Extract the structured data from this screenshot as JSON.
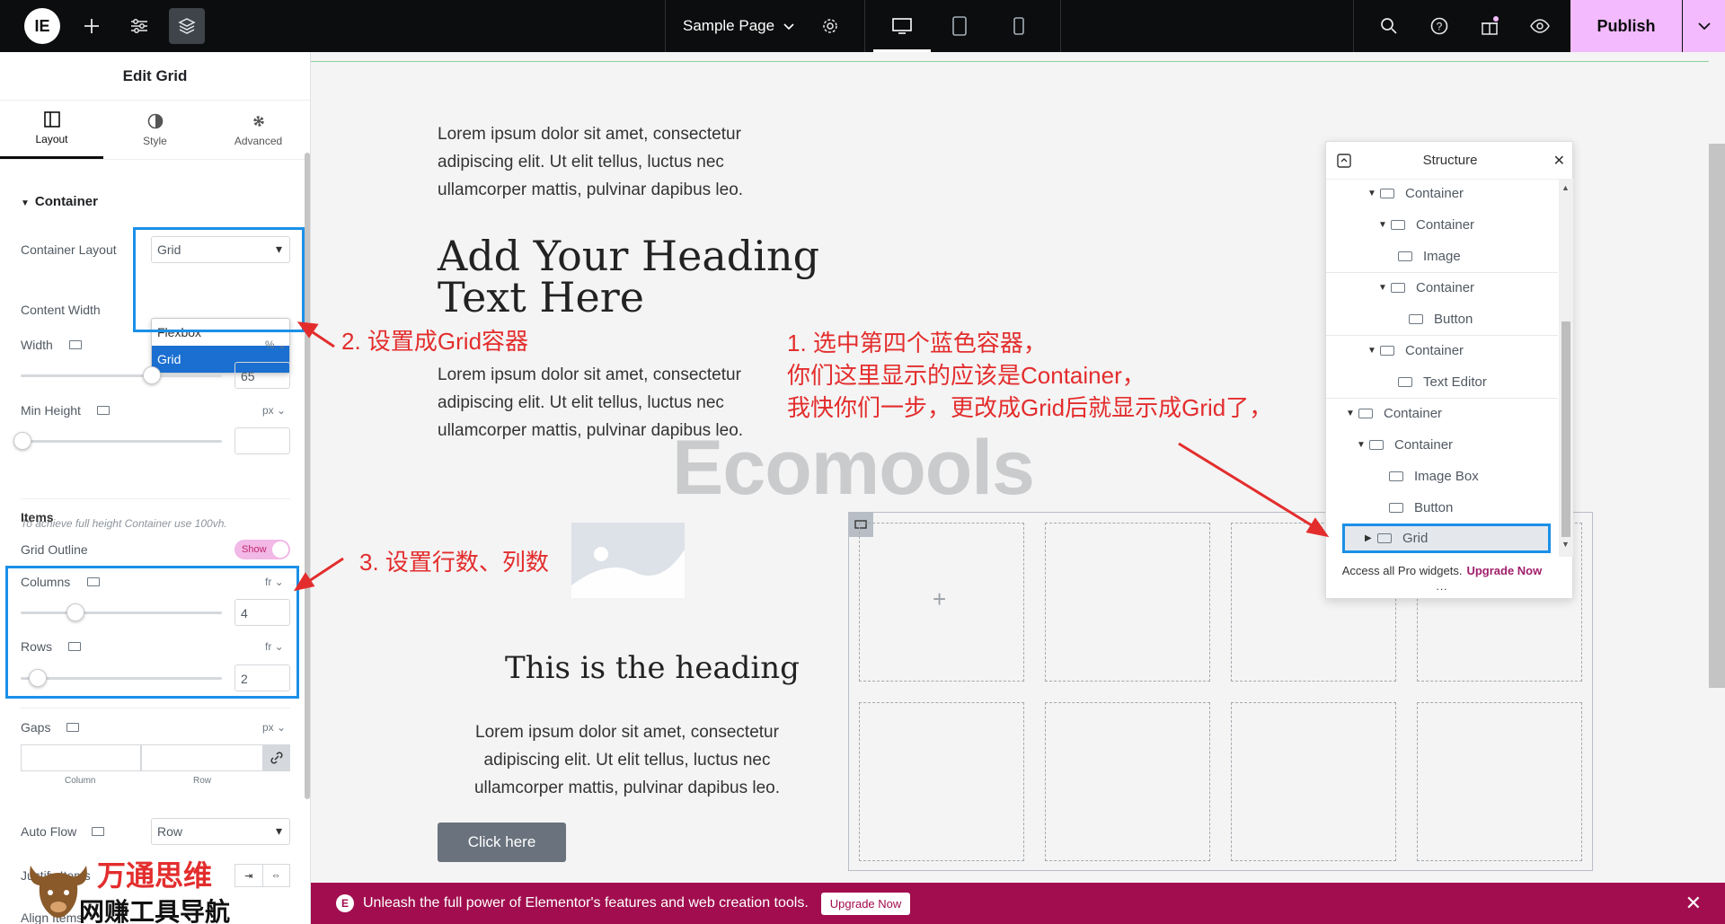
{
  "topbar": {
    "page_name": "Sample Page",
    "publish_label": "Publish"
  },
  "panel": {
    "title": "Edit Grid",
    "tabs": [
      {
        "label": "Layout",
        "active": true
      },
      {
        "label": "Style",
        "active": false
      },
      {
        "label": "Advanced",
        "active": false
      }
    ],
    "section": "Container",
    "container_layout": {
      "label": "Container Layout",
      "value": "Grid",
      "options": [
        "Flexbox",
        "Grid"
      ]
    },
    "content_width_label": "Content Width",
    "width": {
      "label": "Width",
      "unit": "%",
      "value": "65",
      "level": 0.65
    },
    "min_height": {
      "label": "Min Height",
      "unit": "px",
      "value": "",
      "hint": "To achieve full height Container use 100vh."
    },
    "items_heading": "Items",
    "grid_outline": {
      "label": "Grid Outline",
      "state": "Show"
    },
    "columns": {
      "label": "Columns",
      "unit": "fr",
      "value": "4"
    },
    "rows": {
      "label": "Rows",
      "unit": "fr",
      "value": "2"
    },
    "gaps": {
      "label": "Gaps",
      "unit": "px",
      "column_label": "Column",
      "row_label": "Row"
    },
    "auto_flow": {
      "label": "Auto Flow",
      "value": "Row"
    },
    "justify_items_label": "Justify Items",
    "align_items_label": "Align Items"
  },
  "canvas": {
    "paragraph": "Lorem ipsum dolor sit amet, consectetur adipiscing elit. Ut elit tellus, luctus nec ullamcorper mattis, pulvinar dapibus leo.",
    "para_lines": [
      "Lorem ipsum dolor sit amet, consectetur",
      "adipiscing elit. Ut elit tellus, luctus nec",
      "ullamcorper mattis, pulvinar dapibus leo."
    ],
    "heading_lines": [
      "Add Your Heading",
      "Text Here"
    ],
    "heading2": "This is the heading",
    "button": "Click here",
    "watermark": "Ecomools"
  },
  "structure": {
    "title": "Structure",
    "items": [
      {
        "label": "Container",
        "icon": "container-icon"
      },
      {
        "label": "Container",
        "icon": "container-icon"
      },
      {
        "label": "Image",
        "icon": "image-icon"
      },
      {
        "label": "Container",
        "icon": "container-icon"
      },
      {
        "label": "Button",
        "icon": "button-icon"
      },
      {
        "label": "Container",
        "icon": "grid-icon"
      },
      {
        "label": "Text Editor",
        "icon": "text-editor-icon"
      },
      {
        "label": "Container",
        "icon": "container-icon"
      },
      {
        "label": "Container",
        "icon": "container-icon"
      },
      {
        "label": "Image Box",
        "icon": "image-box-icon"
      },
      {
        "label": "Button",
        "icon": "button-icon"
      },
      {
        "label": "Grid",
        "icon": "grid-icon"
      }
    ],
    "footer_text": "Access all Pro widgets.",
    "footer_link": "Upgrade Now",
    "more": "..."
  },
  "annotations": {
    "step1_lines": [
      "1. 选中第四个蓝色容器，",
      "你们这里显示的应该是Container，",
      "我快你们一步，更改成Grid后就显示成Grid了，"
    ],
    "step2": "2. 设置成Grid容器",
    "step3": "3. 设置行数、列数"
  },
  "banner": {
    "text": "Unleash the full power of Elementor's features and web creation tools.",
    "button": "Upgrade Now"
  },
  "brand": {
    "title": "万通思维",
    "subtitle": "网赚工具导航"
  },
  "colors": {
    "publish_bg": "#f3bafd",
    "banner_bg": "#a10d4e",
    "highlight_blue": "#1a90e8",
    "annotation_red": "#e32d2d"
  }
}
